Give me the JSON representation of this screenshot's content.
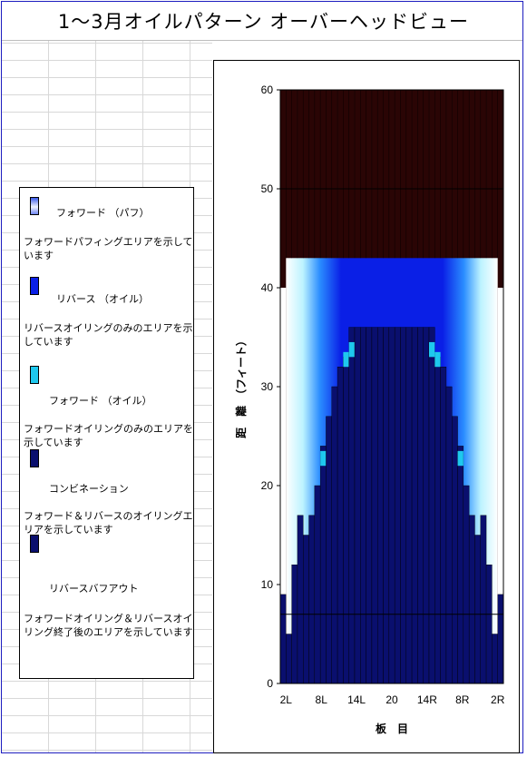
{
  "title": "1～3月オイルパターン オーバーヘッドビュー",
  "legend": {
    "items": [
      {
        "label": "フォワード （パフ）",
        "desc": "フォワードパフィングエリアを示しています",
        "swatch": "#dfe6ff"
      },
      {
        "label": "リバース （オイル）",
        "desc": "リバースオイリングのみのエリアを示しています",
        "swatch": "#0a1fe6"
      },
      {
        "label": "フォワード （オイル）",
        "desc": "フォワードオイリングのみのエリアを示しています",
        "swatch": "#1ec8ee"
      },
      {
        "label": "コンビネーション",
        "desc": "フォワード＆リバースのオイリングエリアを示しています",
        "swatch": "#0a0f6e"
      },
      {
        "label": "リバースバフアウト",
        "desc": "フォワードオイリング＆リバースオイリング終了後のエリアを示しています",
        "swatch": "#0a0f6e"
      }
    ]
  },
  "chart_data": {
    "type": "heatmap",
    "title": "",
    "xlabel": "板　目",
    "ylabel": "距　離　（フィート）",
    "x_tick_labels": [
      "2L",
      "8L",
      "14L",
      "20",
      "14R",
      "8R",
      "2R"
    ],
    "boards": 39,
    "ylim": [
      0,
      60
    ],
    "y_ticks": [
      0,
      10,
      20,
      30,
      40,
      50,
      60
    ],
    "grid": "horizontal at 0, 7, 50, 60 ft",
    "regions": {
      "forward_buff_length_ft": 43,
      "combination_center_top_ft": 36,
      "combination_heights_left_ft": [
        9,
        5,
        12,
        17,
        15,
        17,
        20,
        24,
        27,
        30,
        32,
        33,
        36
      ],
      "forward_oil_heights_left_ft": [
        0,
        0,
        0,
        0,
        0,
        0,
        0,
        22,
        0,
        0,
        0,
        32,
        33
      ],
      "dry_lane_color": "#2a0505",
      "forward_buff_color": "#dfe6ff",
      "reverse_oil_color": "#0a1fe6",
      "forward_oil_color": "#1ec8ee",
      "combination_color": "#0a0f6e"
    }
  }
}
